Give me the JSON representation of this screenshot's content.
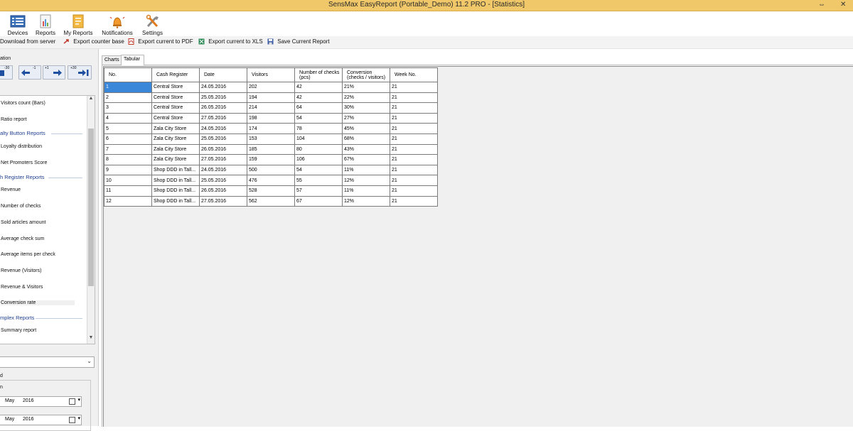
{
  "window": {
    "title": "SensMax EasyReport (Portable_Demo) 11.2 PRO - [Statistics]",
    "controls": [
      "⇔",
      "✕"
    ]
  },
  "ribbon": {
    "buttons": [
      {
        "label": "Devices",
        "icon": "devices-icon"
      },
      {
        "label": "Reports",
        "icon": "reports-icon"
      },
      {
        "label": "My Reports",
        "icon": "my-reports-icon"
      },
      {
        "label": "Notifications",
        "icon": "notifications-icon"
      },
      {
        "label": "Settings",
        "icon": "settings-icon"
      }
    ]
  },
  "toolbar": {
    "items": [
      {
        "label": "Download from server",
        "icon": "download-icon"
      },
      {
        "label": "Export counter base",
        "icon": "export-icon"
      },
      {
        "label": "Export current to PDF",
        "icon": "pdf-icon"
      },
      {
        "label": "Export current to XLS",
        "icon": "xls-icon"
      },
      {
        "label": "Save Current Report",
        "icon": "save-icon"
      }
    ]
  },
  "left": {
    "navigation_label": "ation",
    "nav_buttons": [
      "-30",
      "-1",
      "+1",
      "+30"
    ],
    "report_list": [
      {
        "type": "item",
        "label": "Visitors count (Bars)"
      },
      {
        "type": "item",
        "label": "Ratio report"
      },
      {
        "type": "head",
        "label": "alty Button Reports"
      },
      {
        "type": "item",
        "label": "Loyalty distribution"
      },
      {
        "type": "item",
        "label": "Net Promoters Score"
      },
      {
        "type": "head",
        "label": "h Register Reports"
      },
      {
        "type": "item",
        "label": "Revenue"
      },
      {
        "type": "item",
        "label": "Number of checks"
      },
      {
        "type": "item",
        "label": "Sold articles amount"
      },
      {
        "type": "item",
        "label": "Average check sum"
      },
      {
        "type": "item",
        "label": "Average items per check"
      },
      {
        "type": "item",
        "label": "Revenue (Visitors)"
      },
      {
        "type": "item",
        "label": "Revenue & Visitors"
      },
      {
        "type": "item",
        "label": "Conversion rate",
        "selected": true
      },
      {
        "type": "head",
        "label": "mplex Reports"
      },
      {
        "type": "item",
        "label": "Summary report"
      }
    ],
    "period_label": "d",
    "from_label": "n",
    "date_from": {
      "month": "May",
      "year": "2016"
    },
    "date_to": {
      "month": "May",
      "year": "2016"
    }
  },
  "tabs": [
    {
      "label": "Charts"
    },
    {
      "label": "Tabular",
      "active": true
    }
  ],
  "table": {
    "headers": [
      "No.",
      "Cash Register",
      "Date",
      "Visitors",
      "Number of checks (pcs)",
      "Conversion (checks / visitors)",
      "Week No."
    ],
    "rows": [
      [
        "1",
        "Central Store",
        "24.05.2016",
        "202",
        "42",
        "21%",
        "21"
      ],
      [
        "2",
        "Central Store",
        "25.05.2016",
        "194",
        "42",
        "22%",
        "21"
      ],
      [
        "3",
        "Central Store",
        "26.05.2016",
        "214",
        "64",
        "30%",
        "21"
      ],
      [
        "4",
        "Central Store",
        "27.05.2016",
        "198",
        "54",
        "27%",
        "21"
      ],
      [
        "5",
        "Zala City Store",
        "24.05.2016",
        "174",
        "78",
        "45%",
        "21"
      ],
      [
        "6",
        "Zala City Store",
        "25.05.2016",
        "153",
        "104",
        "68%",
        "21"
      ],
      [
        "7",
        "Zala City Store",
        "26.05.2016",
        "185",
        "80",
        "43%",
        "21"
      ],
      [
        "8",
        "Zala City Store",
        "27.05.2016",
        "159",
        "106",
        "67%",
        "21"
      ],
      [
        "9",
        "Shop DDD in Tall...",
        "24.05.2016",
        "500",
        "54",
        "11%",
        "21"
      ],
      [
        "10",
        "Shop DDD in Tall...",
        "25.05.2016",
        "476",
        "55",
        "12%",
        "21"
      ],
      [
        "11",
        "Shop DDD in Tall...",
        "26.05.2016",
        "528",
        "57",
        "11%",
        "21"
      ],
      [
        "12",
        "Shop DDD in Tall...",
        "27.05.2016",
        "562",
        "67",
        "12%",
        "21"
      ]
    ]
  },
  "colors": {
    "titlebar": "#f0c86a",
    "selection": "#3a86d8",
    "group_header": "#1f3f8f"
  }
}
